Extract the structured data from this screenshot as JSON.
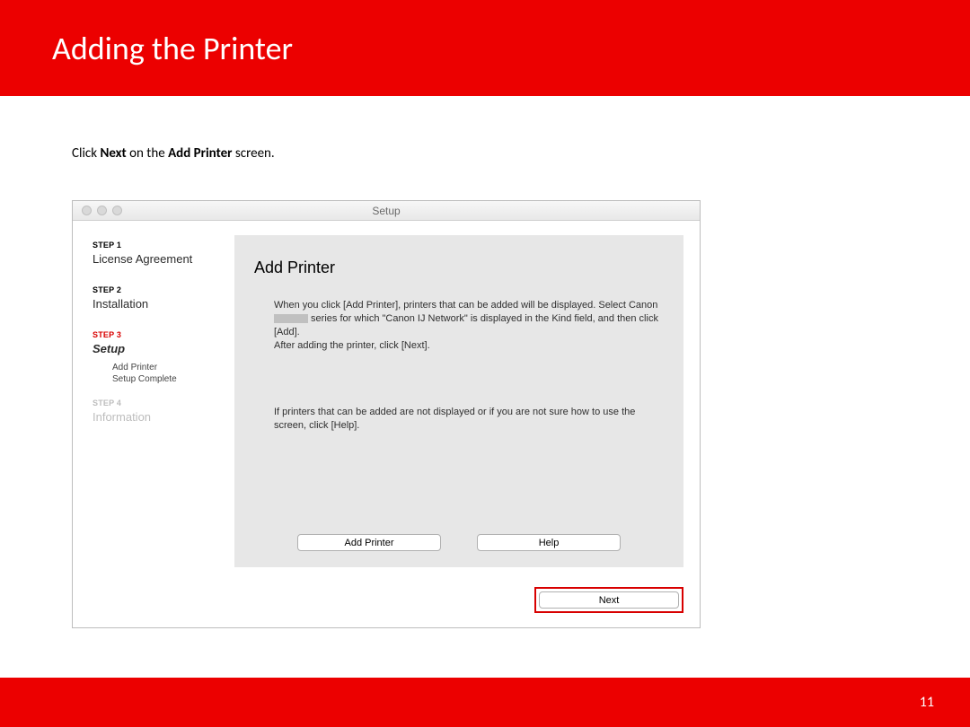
{
  "header": {
    "title": "Adding  the Printer"
  },
  "instruction": {
    "pre": "Click ",
    "bold1": "Next",
    "mid": " on the ",
    "bold2": "Add Printer",
    "post": " screen."
  },
  "window": {
    "title": "Setup",
    "sidebar": {
      "steps": [
        {
          "label": "STEP 1",
          "name": "License Agreement",
          "state": "done"
        },
        {
          "label": "STEP 2",
          "name": "Installation",
          "state": "done"
        },
        {
          "label": "STEP 3",
          "name": "Setup",
          "state": "active",
          "substeps": [
            "Add Printer",
            "Setup Complete"
          ]
        },
        {
          "label": "STEP 4",
          "name": "Information",
          "state": "inactive"
        }
      ]
    },
    "panel": {
      "title": "Add Printer",
      "para1a": "When you click [Add Printer], printers that can be added will be displayed. Select Canon ",
      "para1b": " series for which \"Canon IJ Network\" is displayed in the Kind field, and then click [Add].",
      "para1c": "After adding the printer, click [Next].",
      "para2": "If printers that can be added are not displayed or if you are not sure how to use the screen, click [Help].",
      "buttons": {
        "add": "Add Printer",
        "help": "Help",
        "next": "Next"
      }
    }
  },
  "page_number": "11"
}
